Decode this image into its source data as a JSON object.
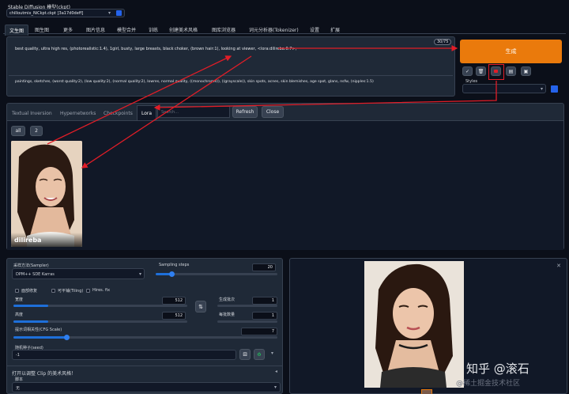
{
  "header": {
    "model_label": "Stable Diffusion 模型(ckpt)",
    "model_value": "chilloutmix_NiCkpt.ckpt [3a17d0deff]"
  },
  "tabs": [
    "文生图",
    "图生图",
    "更多",
    "图片信息",
    "模型合并",
    "训练",
    "创建美术风格",
    "图库浏览器",
    "词元分析器(Tokenizer)",
    "设置",
    "扩展"
  ],
  "prompt": {
    "positive": "best quality, ultra high res, (photorealistic:1.4), 1girl,   busty, large breasts, black choker, (brown hair:1), looking at viewer, <lora:dilireba:0.7>,",
    "negative": "paintings, sketches, (worst quality:2), (low quality:2), (normal quality:2), lowres, normal quality, ((monochrome)), ((grayscale)), skin spots, acnes, skin blemishes, age spot, glans, nsfw, (nipples:1.5)",
    "token_count": "30/75"
  },
  "generate": {
    "label": "生成",
    "styles_label": "Styles",
    "accent": "#ea7a0c"
  },
  "tool_icons": [
    "check-icon",
    "trash-icon",
    "red-card-icon",
    "clipboard-icon",
    "save-icon"
  ],
  "network_tabs": [
    "Textual Inversion",
    "Hypernetworks",
    "Checkpoints",
    "Lora"
  ],
  "search_placeholder": "Search...",
  "refresh_label": "Refresh",
  "close_label": "Close",
  "filter_buttons": [
    "all",
    "2"
  ],
  "lora_card": {
    "name": "dilireba"
  },
  "settings": {
    "sampler_label": "采样方法(Sampler)",
    "sampler_value": "DPM++ SDE Karras",
    "steps_label": "Sampling steps",
    "steps_value": "20",
    "steps_fraction": 0.13,
    "face_restore": "面部修复",
    "tiling": "可平铺(Tiling)",
    "hires": "Hires. fix",
    "width_label": "宽度",
    "width_value": "512",
    "width_fraction": 0.2,
    "height_label": "高度",
    "height_value": "512",
    "height_fraction": 0.2,
    "batch_count_label": "生成批次",
    "batch_count_value": "1",
    "batch_size_label": "每批数量",
    "batch_size_value": "1",
    "cfg_label": "提示词相关性(CFG Scale)",
    "cfg_value": "7",
    "cfg_fraction": 0.2,
    "seed_label": "随机种子(seed)",
    "seed_value": "-1",
    "clip_label": "打开以调整 Clip 的美术风格！",
    "script_label": "脚本",
    "script_value": "无",
    "swap_icon": "⇅"
  },
  "watermark": {
    "main": "知乎 @滚石",
    "sub": "@稀土掘金技术社区"
  },
  "colors": {
    "arrow": "#e11d27",
    "highlight_box": "#e11d27",
    "slider": "#1e6fd9"
  }
}
